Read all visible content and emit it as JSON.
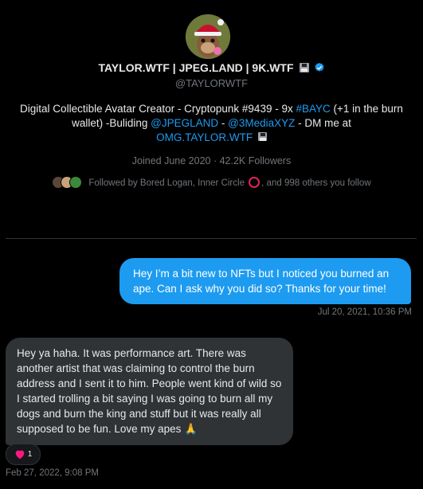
{
  "profile": {
    "name": "TAYLOR.WTF | JPEG.LAND | 9K.WTF",
    "handle": "@TAYLORWTF",
    "bio_start": "Digital Collectible Avatar Creator - Cryptopunk #9439 - 9x ",
    "bio_link_bayc": "#BAYC",
    "bio_mid1": " (+1 in the burn wallet) -Buliding ",
    "bio_link_jpegland": "@JPEGLAND",
    "bio_mid2": " - ",
    "bio_link_3media": "@3MediaXYZ",
    "bio_mid3": " - DM me at ",
    "bio_link_omg": "OMG.TAYLOR.WTF",
    "joined": "Joined June 2020",
    "separator": " · ",
    "followers": "42.2K Followers",
    "followed_by_start": "Followed by Bored Logan, Inner Circle ",
    "followed_by_end": ", and 998 others you follow"
  },
  "messages": {
    "outgoing_text": "Hey I’m a bit new to NFTs but I noticed you burned an ape. Can I ask why you did so? Thanks for your time!",
    "outgoing_time": "Jul 20, 2021, 10:36 PM",
    "incoming_text": "Hey ya haha. It was performance art. There was another artist that was claiming to control the burn address and I sent it to him. People went kind of wild so I started trolling a bit saying I was going to burn all my dogs and burn the king and stuff but it was really all supposed to be fun. Love my apes 🙏",
    "reaction_count": "1",
    "incoming_time": "Feb 27, 2022, 9:08 PM"
  },
  "icons": {
    "verified": "verified-badge-icon",
    "floppy": "floppy-disk-icon",
    "heart": "heart-icon"
  },
  "colors": {
    "accent": "#1d9bf0",
    "background": "#000000",
    "bubble_in": "#2f3336",
    "heart": "#f91880"
  }
}
